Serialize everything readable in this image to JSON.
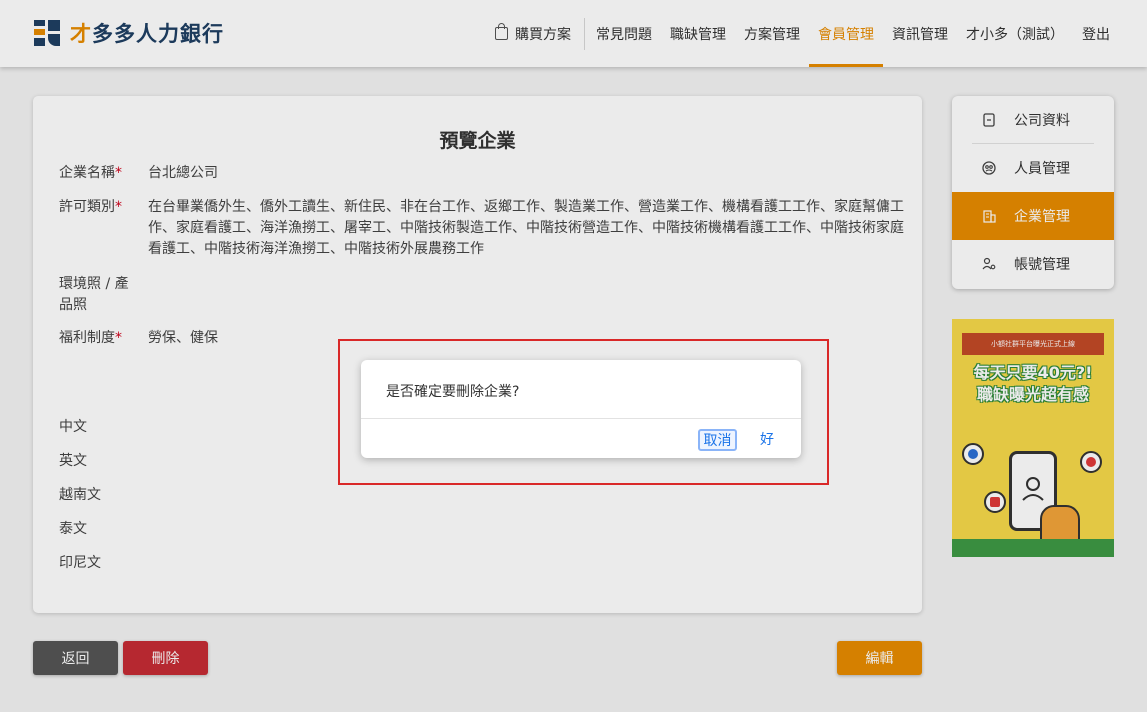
{
  "header": {
    "logo_text_1": "才",
    "logo_text_2": "多多人力銀行",
    "nav": {
      "buy": "購買方案",
      "faq": "常見問題",
      "jobs": "職缺管理",
      "plans": "方案管理",
      "member": "會員管理",
      "info": "資訊管理",
      "user": "才小多（測試）",
      "logout": "登出"
    },
    "active_nav": "會員管理"
  },
  "card": {
    "title": "預覽企業",
    "fields": {
      "company_name": {
        "label": "企業名稱",
        "value": "台北總公司"
      },
      "permit_type": {
        "label": "許可類別",
        "value": "在台畢業僑外生、僑外工讀生、新住民、非在台工作、返鄉工作、製造業工作、營造業工作、機構看護工工作、家庭幫傭工作、家庭看護工、海洋漁撈工、屠宰工、中階技術製造工作、中階技術營造工作、中階技術機構看護工工作、中階技術家庭看護工、中階技術海洋漁撈工、中階技術外展農務工作"
      },
      "env_license": {
        "label": "環境照 / 產品照",
        "value": ""
      },
      "welfare": {
        "label": "福利制度",
        "value": "勞保、健保"
      }
    },
    "required_mark": "*",
    "languages": [
      "中文",
      "英文",
      "越南文",
      "泰文",
      "印尼文"
    ]
  },
  "side_menu": {
    "items": [
      {
        "label": "公司資料",
        "icon": "document-icon"
      },
      {
        "label": "人員管理",
        "icon": "people-icon"
      },
      {
        "label": "企業管理",
        "icon": "building-icon"
      },
      {
        "label": "帳號管理",
        "icon": "user-settings-icon"
      }
    ],
    "active": "企業管理"
  },
  "ad": {
    "ribbon": "小額社群平台曝光正式上線",
    "headline_1": "每天只要40元?!",
    "headline_2": "職缺曝光超有感"
  },
  "dialog": {
    "message": "是否確定要刪除企業?",
    "cancel": "取消",
    "ok": "好"
  },
  "buttons": {
    "back": "返回",
    "delete": "刪除",
    "edit": "編輯"
  },
  "colors": {
    "accent": "#e88b00",
    "brand": "#1f3f63",
    "danger": "#c62c35",
    "highlight_box": "#d92828",
    "link": "#1a73e8"
  }
}
